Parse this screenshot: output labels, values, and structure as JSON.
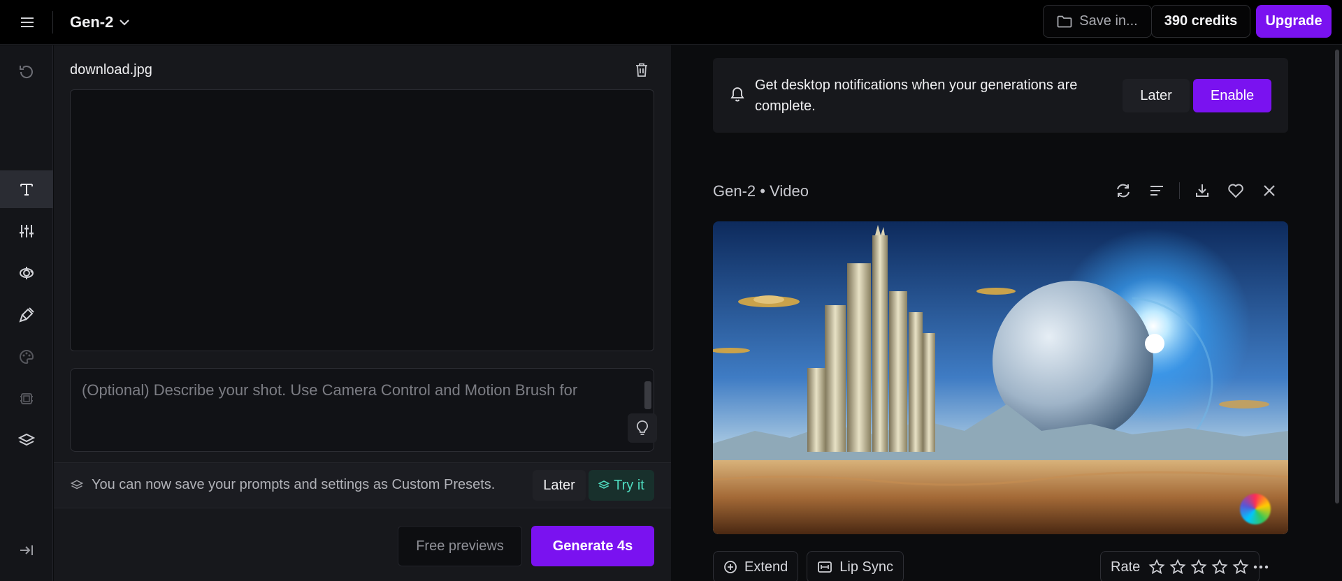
{
  "header": {
    "app_name": "Gen-2",
    "save_in_label": "Save in...",
    "credits_label": "390 credits",
    "upgrade_label": "Upgrade"
  },
  "rail": {
    "items": [
      "history-icon",
      "text-icon",
      "sliders-icon",
      "camera-control-icon",
      "motion-brush-icon",
      "palette-icon",
      "frames-icon",
      "presets-icon",
      "collapse-icon"
    ],
    "active": "text-icon"
  },
  "editor": {
    "file_name": "download.jpg",
    "prompt_placeholder": "(Optional) Describe your shot. Use Camera Control and Motion Brush for",
    "presets_notice": "You can now save your prompts and settings as Custom Presets.",
    "presets_later_label": "Later",
    "presets_try_label": "Try it",
    "free_previews_label": "Free previews",
    "generate_label": "Generate 4s"
  },
  "notification": {
    "text": "Get desktop notifications when your generations are complete.",
    "later_label": "Later",
    "enable_label": "Enable"
  },
  "result": {
    "title": "Gen-2 • Video",
    "extend_label": "Extend",
    "lip_sync_label": "Lip Sync",
    "rate_label": "Rate",
    "stars": 5
  },
  "colors": {
    "accent": "#7a12f0",
    "try_it": "#4fdcc0"
  }
}
